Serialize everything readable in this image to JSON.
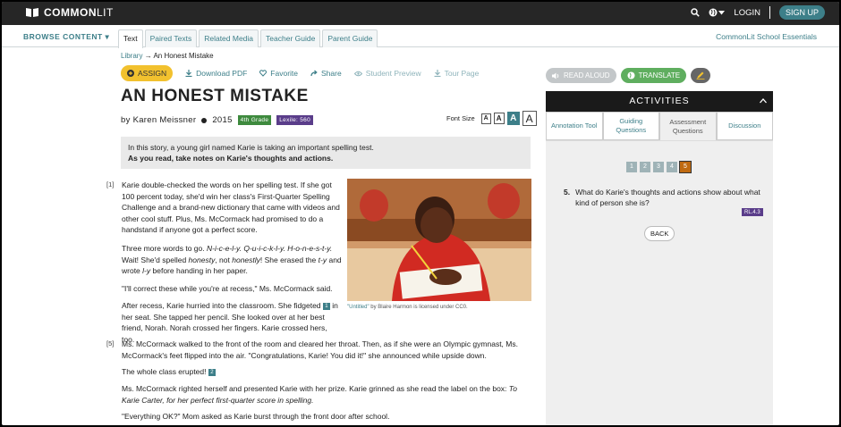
{
  "header": {
    "logo_bold": "COMMON",
    "logo_rest": "LIT",
    "login": "LOGIN",
    "signup": "SIGN UP"
  },
  "subnav": {
    "browse": "BROWSE CONTENT ▾",
    "tabs": [
      "Text",
      "Paired Texts",
      "Related Media",
      "Teacher Guide",
      "Parent Guide"
    ],
    "essentials": "CommonLit School Essentials"
  },
  "breadcrumb": {
    "library": "Library",
    "arrow": "→",
    "current": "An Honest Mistake"
  },
  "actions": {
    "assign": "ASSIGN",
    "download": "Download PDF",
    "favorite": "Favorite",
    "share": "Share",
    "student_preview": "Student Preview",
    "tour": "Tour Page"
  },
  "text": {
    "title": "AN HONEST MISTAKE",
    "author": "by Karen Meissner",
    "year": "2015",
    "grade": "4th Grade",
    "lexile": "Lexile: 560",
    "font_size_label": "Font Size",
    "font_sizes": [
      "A",
      "A",
      "A",
      "A"
    ],
    "intro_1": "In this story, a young girl named Karie is taking an important spelling test.",
    "intro_2": "As you read, take notes on Karie's thoughts and actions."
  },
  "story": {
    "p1_num": "[1]",
    "p1": "Karie double-checked the words on her spelling test. If she got 100 percent today, she'd win her class's First-Quarter Spelling Challenge and a brand-new dictionary that came with videos and other cool stuff. Plus, Ms. McCormack had promised to do a handstand if anyone got a perfect score.",
    "p2a": "Three more words to go. ",
    "p2b": "N-i-c-e-l-y. Q-u-i-c-k-l-y. H-o-n-e-s-t-y.",
    "p2c": " Wait! She'd spelled ",
    "p2d": "honesty",
    "p2e": ", not ",
    "p2f": "honestly",
    "p2g": "! She erased the ",
    "p2h": "t-y",
    "p2i": " and wrote ",
    "p2j": "l-y",
    "p2k": " before handing in her paper.",
    "p3": "\"I'll correct these while you're at recess,\" Ms. McCormack said.",
    "p4a": "After recess, Karie hurried into the classroom. She fidgeted",
    "note1": "1",
    "p4b": " in her seat. She tapped her pencil. She looked over at her best friend, Norah. Norah crossed her fingers. Karie crossed hers, too.",
    "p5_num": "[5]",
    "p5": "Ms. McCormack walked to the front of the room and cleared her throat. Then, as if she were an Olympic gymnast, Ms. McCormack's feet flipped into the air. \"Congratulations, Karie! You did it!\" she announced while upside down.",
    "p6": "The whole class erupted!",
    "note2": "2",
    "p7a": "Ms. McCormack righted herself and presented Karie with her prize. Karie grinned as she read the label on the box: ",
    "p7b": "To Karie Carter, for her perfect first-quarter score in spelling.",
    "p8": "\"Everything OK?\" Mom asked as Karie burst through the front door after school.",
    "caption_link": "\"Untitled\"",
    "caption_rest": " by Blaire Harmon is licensed under CC0."
  },
  "panel": {
    "read_aloud": "READ ALOUD",
    "translate": "TRANSLATE",
    "activities": "ACTIVITIES",
    "tabs": [
      "Annotation Tool",
      "Guiding Questions",
      "Assessment Questions",
      "Discussion"
    ],
    "question_nums": [
      "1",
      "2",
      "3",
      "4",
      "5"
    ],
    "question_number": "5.",
    "question_text": "What do Karie's thoughts and actions show about what kind of person she is?",
    "standard": "RL.4.3",
    "back": "BACK"
  },
  "colors": {
    "accent": "#3d7f89",
    "assign": "#f2c12e",
    "grade": "#3e8a3e",
    "lexile": "#5a3d8a",
    "current_q": "#c06a10"
  }
}
